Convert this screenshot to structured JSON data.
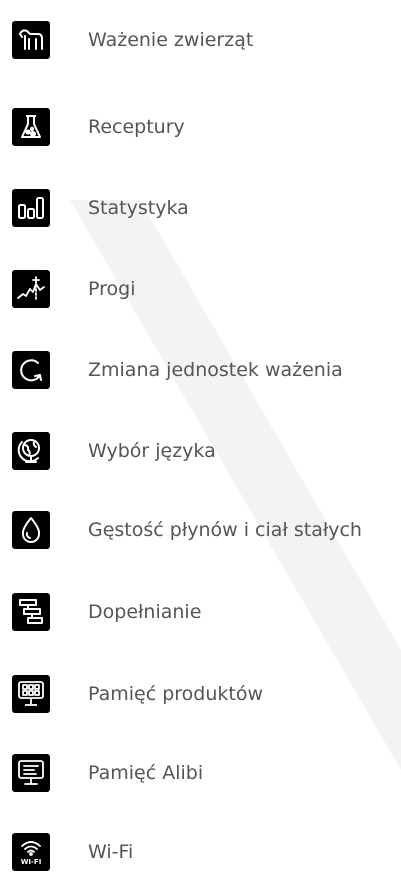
{
  "colors": {
    "tile_background": "#000000",
    "icon": "#ffffff",
    "label_text": "#555555",
    "page_background": "#ffffff"
  },
  "menu": {
    "items": [
      {
        "icon": "horse-icon",
        "label": "Ważenie zwierząt"
      },
      {
        "icon": "flask-icon",
        "label": "Receptury"
      },
      {
        "icon": "bar-chart-icon",
        "label": "Statystyka"
      },
      {
        "icon": "threshold-graph-icon",
        "label": "Progi"
      },
      {
        "icon": "refresh-arrow-icon",
        "label": "Zmiana jednostek ważenia"
      },
      {
        "icon": "globe-icon",
        "label": "Wybór języka"
      },
      {
        "icon": "drop-icon",
        "label": "Gęstość płynów i ciał stałych"
      },
      {
        "icon": "filling-steps-icon",
        "label": "Dopełnianie"
      },
      {
        "icon": "product-memory-icon",
        "label": "Pamięć produktów"
      },
      {
        "icon": "alibi-memory-icon",
        "label": "Pamięć Alibi"
      },
      {
        "icon": "wifi-icon",
        "label": "Wi-Fi",
        "icon_text": "WI-FI"
      }
    ]
  }
}
